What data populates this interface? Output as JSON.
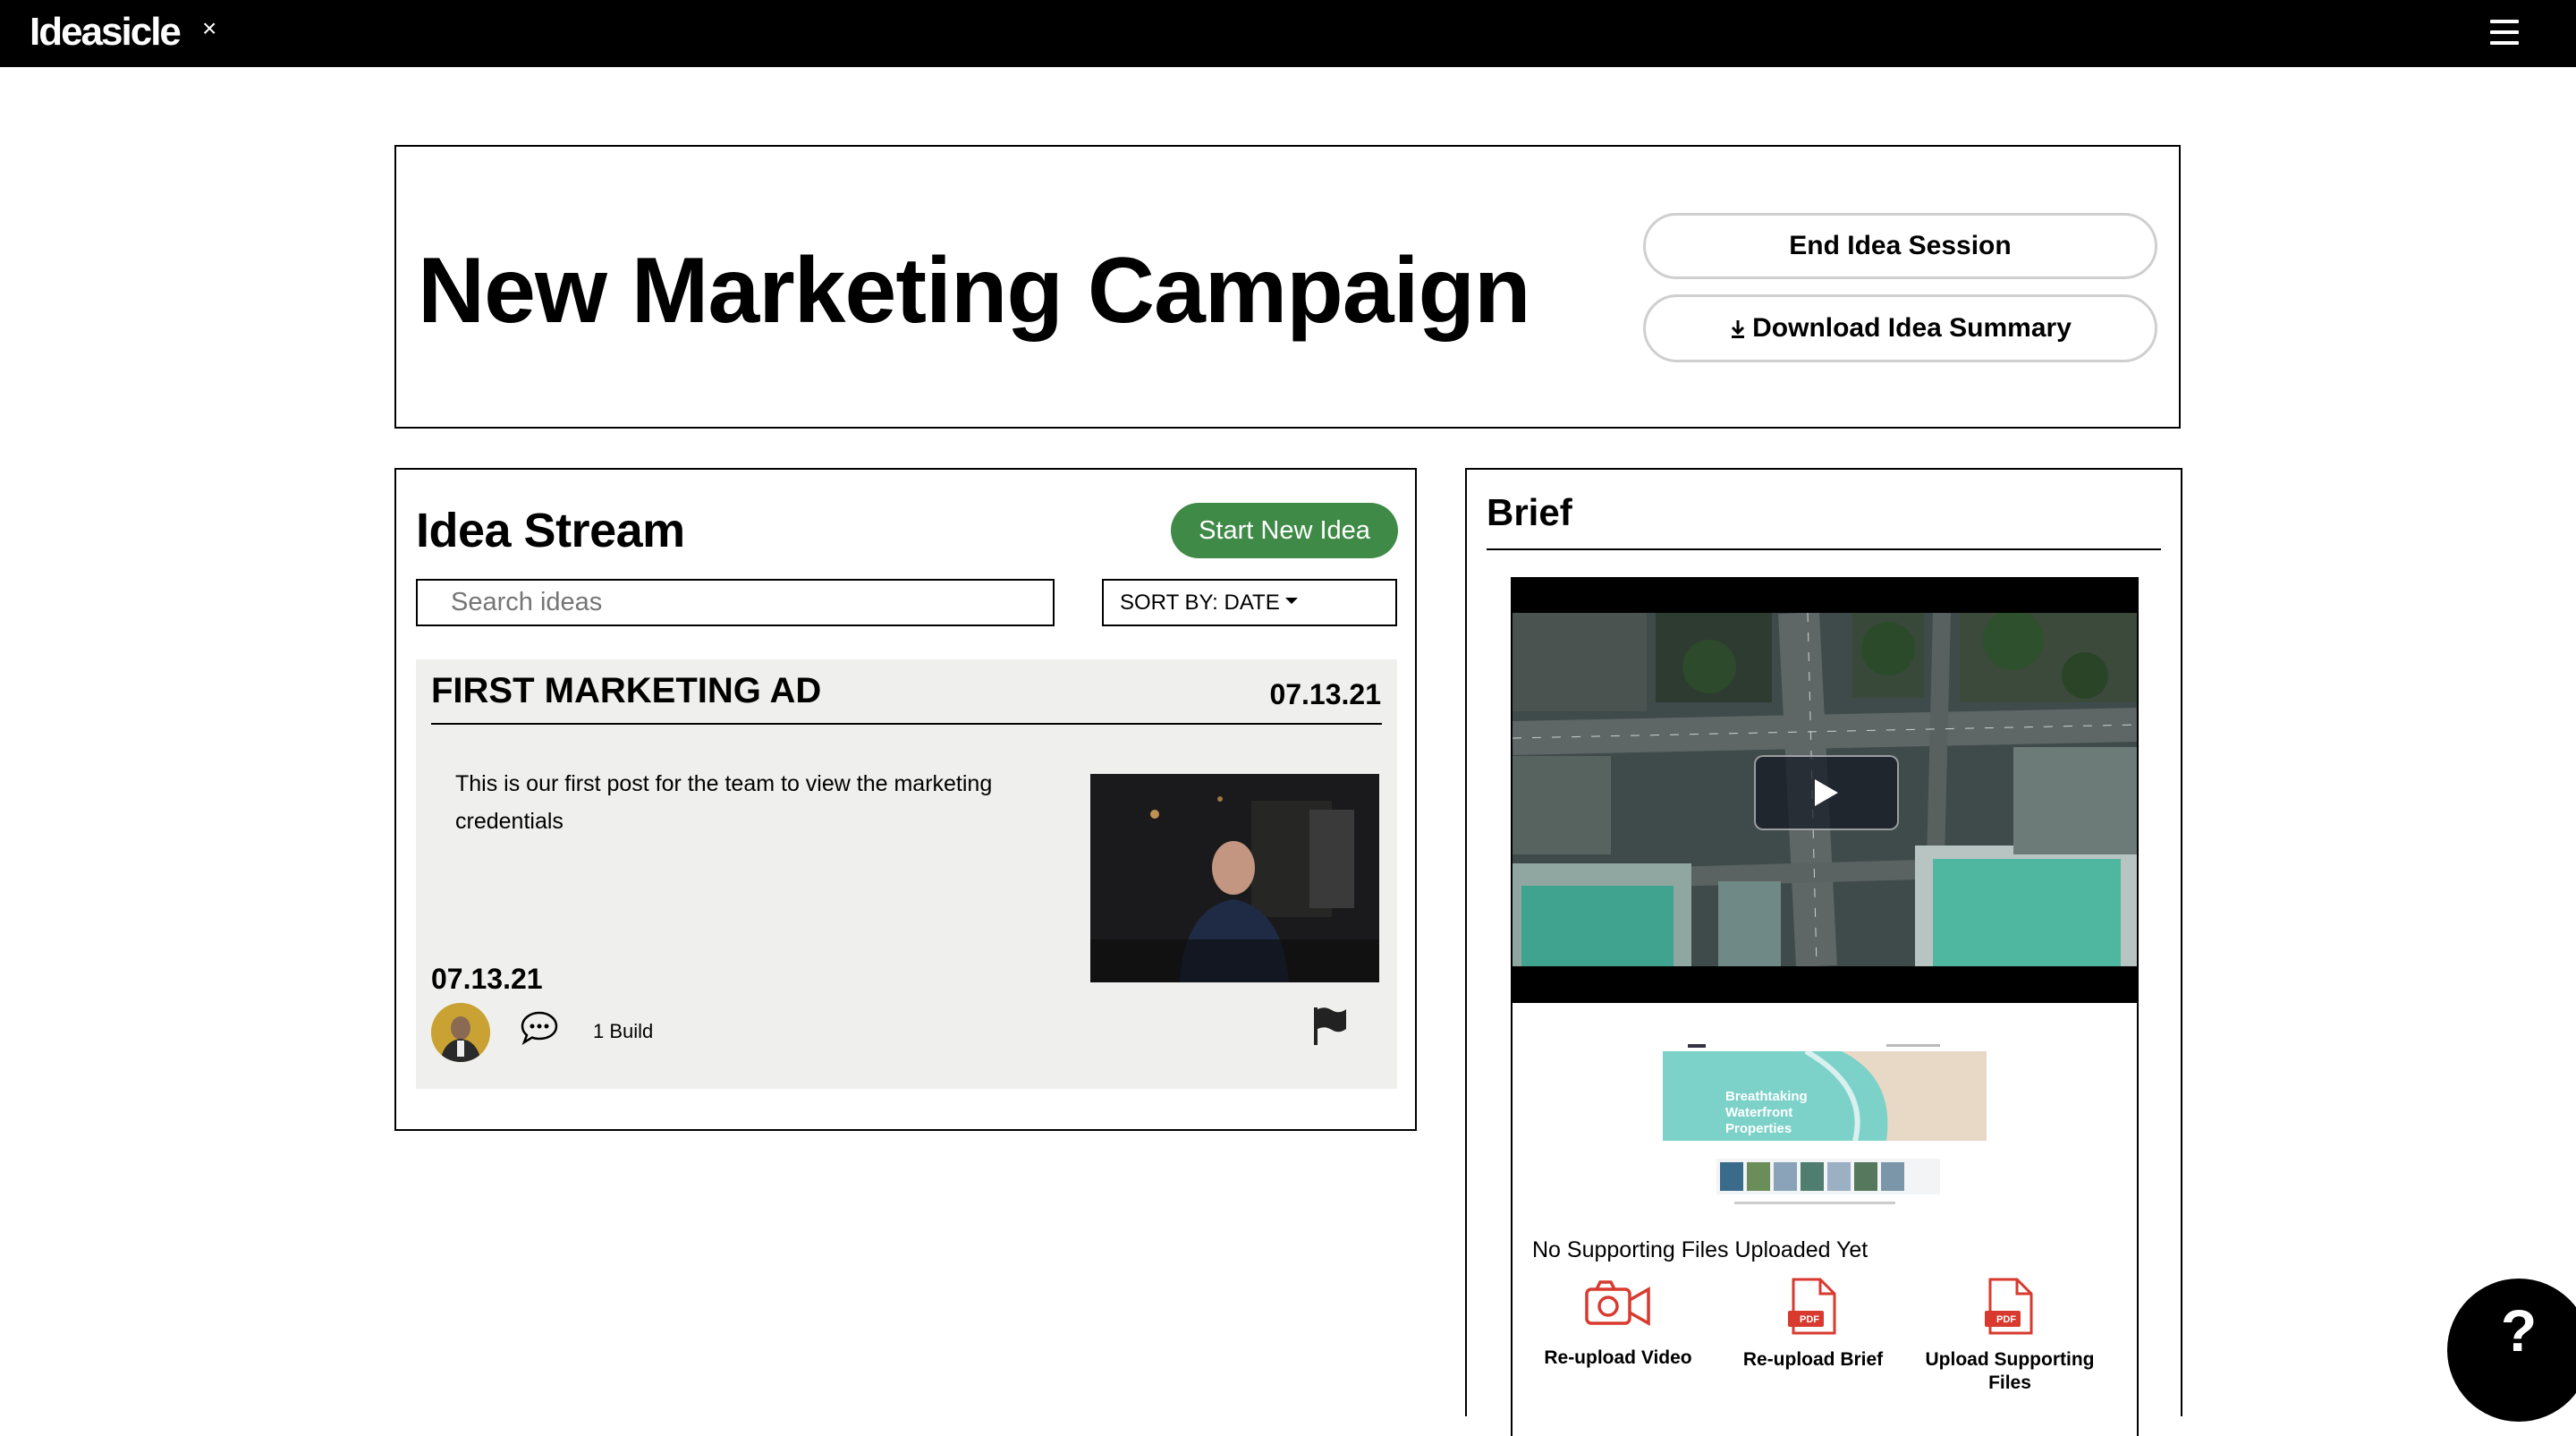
{
  "app": {
    "logo": "Ideasicle",
    "close_symbol": "×",
    "menu_icon": "hamburger-menu-icon"
  },
  "header": {
    "title": "New Marketing Campaign",
    "end_session_label": "End Idea Session",
    "download_summary_label": "Download Idea Summary"
  },
  "idea_stream": {
    "title": "Idea Stream",
    "start_new_label": "Start New Idea",
    "search_placeholder": "Search ideas",
    "search_value": "",
    "sort_label": "SORT BY: DATE",
    "ideas": [
      {
        "title": "FIRST MARKETING AD",
        "date": "07.13.21",
        "description": "This is our first post for the team to view the marketing credentials",
        "posted_date": "07.13.21",
        "builds": "1 Build"
      }
    ]
  },
  "brief": {
    "title": "Brief",
    "site_preview_heading": "Breathtaking Waterfront Properties",
    "no_files_text": "No Supporting Files Uploaded Yet",
    "actions": [
      {
        "label": "Re-upload Video",
        "icon": "video-camera-icon"
      },
      {
        "label": "Re-upload Brief",
        "icon": "pdf-file-icon",
        "badge": "PDF"
      },
      {
        "label": "Upload Supporting Files",
        "icon": "pdf-file-icon",
        "badge": "PDF"
      }
    ]
  },
  "help": {
    "symbol": "?"
  },
  "colors": {
    "topbar": "#000000",
    "accent_green": "#3f8a47",
    "card_bg": "#eff0ee",
    "icon_red": "#d83a2f"
  }
}
